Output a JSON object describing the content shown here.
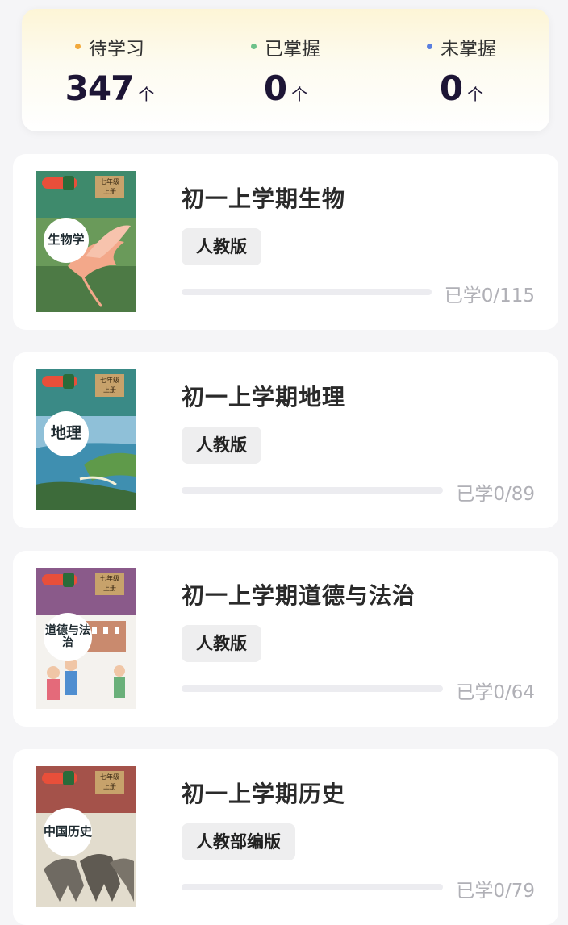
{
  "stats": {
    "pending": {
      "label": "待学习",
      "value": "347",
      "unit": "个",
      "dot_color": "#f2a93b"
    },
    "mastered": {
      "label": "已掌握",
      "value": "0",
      "unit": "个",
      "dot_color": "#6dc18a"
    },
    "unmastered": {
      "label": "未掌握",
      "value": "0",
      "unit": "个",
      "dot_color": "#5a7fe0"
    }
  },
  "courses": [
    {
      "title": "初一上学期生物",
      "edition": "人教版",
      "progress_text": "已学0/115",
      "learned": 0,
      "total": 115,
      "cover": {
        "name": "生物学",
        "grade": "七年级",
        "term": "上册",
        "top_color": "#3e8a6c",
        "art": "bird"
      }
    },
    {
      "title": "初一上学期地理",
      "edition": "人教版",
      "progress_text": "已学0/89",
      "learned": 0,
      "total": 89,
      "cover": {
        "name": "地理",
        "grade": "七年级",
        "term": "上册",
        "top_color": "#3a8a86",
        "art": "coast"
      }
    },
    {
      "title": "初一上学期道德与法治",
      "edition": "人教版",
      "progress_text": "已学0/64",
      "learned": 0,
      "total": 64,
      "cover": {
        "name": "道德与法治",
        "grade": "七年级",
        "term": "上册",
        "top_color": "#8a5a8a",
        "art": "children"
      }
    },
    {
      "title": "初一上学期历史",
      "edition": "人教部编版",
      "progress_text": "已学0/79",
      "learned": 0,
      "total": 79,
      "cover": {
        "name": "中国历史",
        "grade": "七年级",
        "term": "上册",
        "top_color": "#a4524a",
        "art": "horses"
      }
    }
  ]
}
